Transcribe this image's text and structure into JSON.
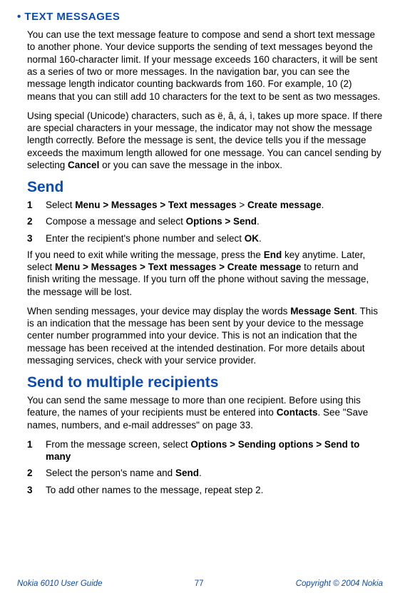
{
  "section": {
    "heading": "• TEXT MESSAGES",
    "para1": "You can use the text message feature to compose and send a short text message to another phone. Your device supports the sending of text messages beyond the normal 160-character limit. If your message exceeds 160 characters, it will be sent as a series of two or more messages. In the navigation bar, you can see the message length indicator counting backwards from 160. For example, 10 (2) means that you can still add 10 characters for the text to be sent as two messages.",
    "para2_pre": "Using special (Unicode) characters, such as ë, â, á, ì, takes up more space. If there are special characters in your message, the indicator may not show the message length correctly. Before the message is sent, the device tells you if the message exceeds the maximum length allowed for one message. You can cancel sending by selecting ",
    "para2_bold": "Cancel",
    "para2_post": " or you can save the message in the inbox."
  },
  "send": {
    "heading": "Send",
    "steps": [
      {
        "num": "1",
        "pre": "Select ",
        "bold1": "Menu > Messages > Text messages",
        "mid": " > ",
        "bold2": "Create message",
        "post": "."
      },
      {
        "num": "2",
        "pre": "Compose a message and select ",
        "bold1": "Options > Send",
        "mid": "",
        "bold2": "",
        "post": "."
      },
      {
        "num": "3",
        "pre": "Enter the recipient's phone number and select ",
        "bold1": "OK",
        "mid": "",
        "bold2": "",
        "post": "."
      }
    ],
    "afterSteps1_pre": "If you need to exit while writing the message, press the ",
    "afterSteps1_b1": "End",
    "afterSteps1_mid": " key anytime. Later, select ",
    "afterSteps1_b2": "Menu > Messages > Text messages > Create message",
    "afterSteps1_post": " to return and finish writing the message. If you turn off the phone without saving the message, the message will be lost.",
    "afterSteps2_pre": "When sending messages, your device may display the words ",
    "afterSteps2_b1": "Message Sent",
    "afterSteps2_post": ". This is an indication that the message has been sent by your device to the message center number programmed into your device. This is not an indication that the message has been received at the intended destination. For more details about messaging services, check with your service provider."
  },
  "sendMulti": {
    "heading": "Send to multiple recipients",
    "para_pre": "You can send the same message to more than one recipient. Before using this feature, the names of your recipients must be entered into ",
    "para_b": "Contacts",
    "para_post": ". See \"Save names, numbers, and e-mail addresses\" on page 33.",
    "steps": [
      {
        "num": "1",
        "pre": "From the message screen, select ",
        "bold1": "Options > Sending options > Send to many",
        "post": ""
      },
      {
        "num": "2",
        "pre": "Select the person's name and ",
        "bold1": "Send",
        "post": "."
      },
      {
        "num": "3",
        "pre": "To add other names to the message, repeat step 2.",
        "bold1": "",
        "post": ""
      }
    ]
  },
  "footer": {
    "left": "Nokia 6010 User Guide",
    "center": "77",
    "right": "Copyright © 2004 Nokia"
  }
}
